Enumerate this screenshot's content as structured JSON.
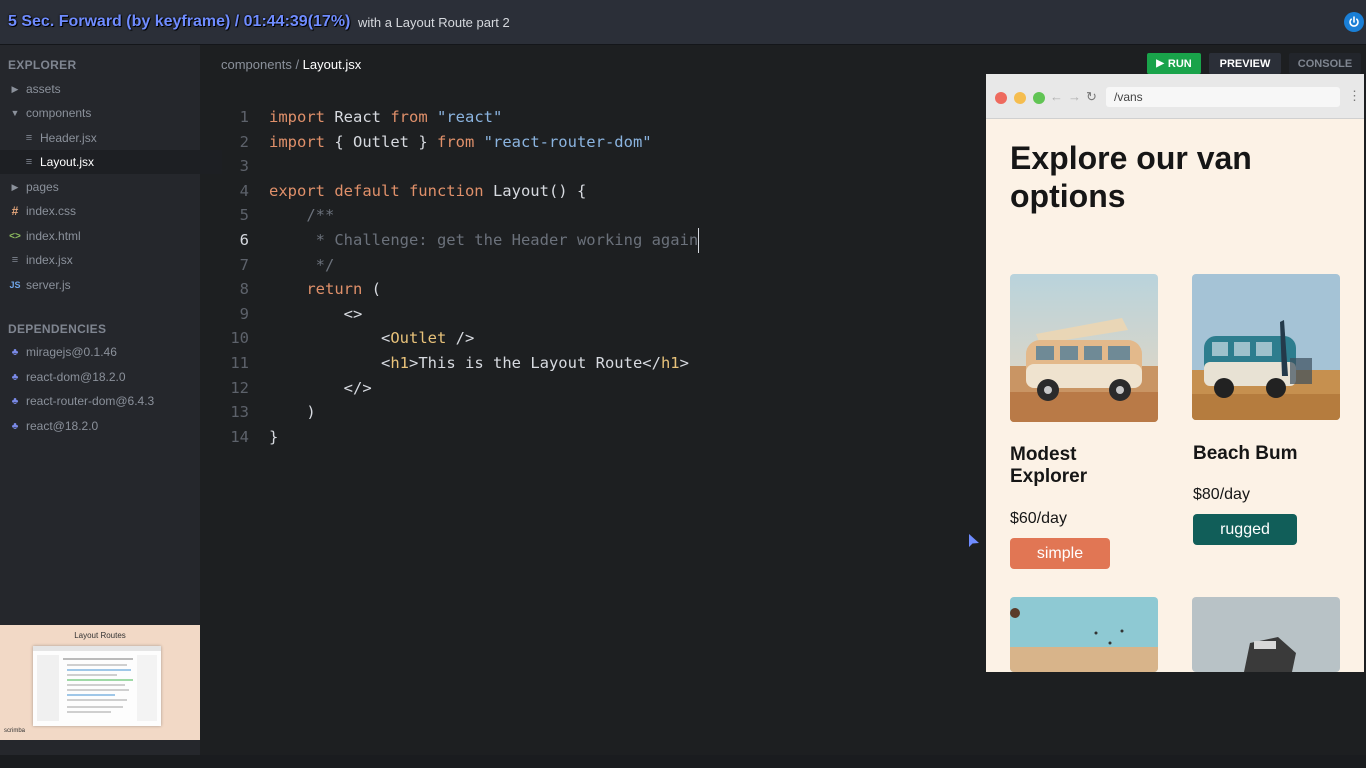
{
  "topbar": {
    "overlay": "5 Sec. Forward (by keyframe) / 01:44:39(17%)",
    "lesson_title": "with a Layout Route part 2",
    "power_icon": "power-icon"
  },
  "explorer": {
    "heading": "EXPLORER",
    "items": [
      {
        "label": "assets",
        "icon": "caret-right-icon"
      },
      {
        "label": "components",
        "icon": "caret-down-icon"
      },
      {
        "label": "Header.jsx",
        "icon": "file-icon"
      },
      {
        "label": "Layout.jsx",
        "icon": "file-icon"
      },
      {
        "label": "pages",
        "icon": "caret-right-icon"
      },
      {
        "label": "index.css",
        "icon": "css-icon"
      },
      {
        "label": "index.html",
        "icon": "html-icon"
      },
      {
        "label": "index.jsx",
        "icon": "file-icon"
      },
      {
        "label": "server.js",
        "icon": "js-icon"
      }
    ]
  },
  "dependencies": {
    "heading": "DEPENDENCIES",
    "items": [
      "miragejs@0.1.46",
      "react-dom@18.2.0",
      "react-router-dom@6.4.3",
      "react@18.2.0"
    ]
  },
  "thumbnail": {
    "title": "Layout Routes",
    "brand": "scrimba"
  },
  "breadcrumb": {
    "folder": "components",
    "separator": " / ",
    "file": "Layout.jsx"
  },
  "code": {
    "current_line": 6,
    "lines": [
      "import React from \"react\"",
      "import { Outlet } from \"react-router-dom\"",
      "",
      "export default function Layout() {",
      "    /**",
      "     * Challenge: get the Header working again",
      "     */",
      "    return (",
      "        <>",
      "            <Outlet />",
      "            <h1>This is the Layout Route</h1>",
      "        </>",
      "    )",
      "}"
    ]
  },
  "toolbar": {
    "run": "RUN",
    "preview": "PREVIEW",
    "console": "CONSOLE"
  },
  "preview": {
    "url": "/vans",
    "heading": "Explore our van options",
    "vans": [
      {
        "name": "Modest Explorer",
        "price": "$60/day",
        "type": "simple",
        "color": "#e17654"
      },
      {
        "name": "Beach Bum",
        "price": "$80/day",
        "type": "rugged",
        "color": "#115e59"
      }
    ]
  },
  "colors": {
    "accent_run": "#19a34a",
    "badge_simple": "#e17654",
    "badge_rugged": "#115e59"
  }
}
